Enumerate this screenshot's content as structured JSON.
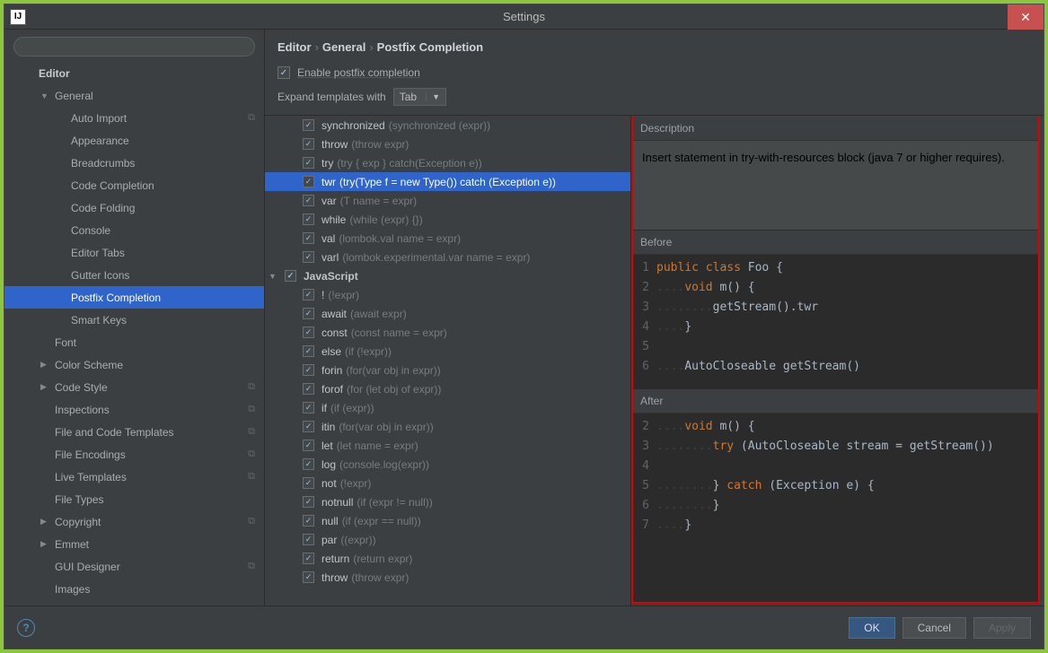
{
  "window": {
    "title": "Settings",
    "app_icon": "IJ"
  },
  "search": {
    "placeholder": ""
  },
  "sidebar": {
    "header": "Editor",
    "items": [
      {
        "label": "General",
        "level": 1,
        "expandable": true,
        "expanded": true
      },
      {
        "label": "Auto Import",
        "level": 2,
        "copy": true
      },
      {
        "label": "Appearance",
        "level": 2
      },
      {
        "label": "Breadcrumbs",
        "level": 2
      },
      {
        "label": "Code Completion",
        "level": 2
      },
      {
        "label": "Code Folding",
        "level": 2
      },
      {
        "label": "Console",
        "level": 2
      },
      {
        "label": "Editor Tabs",
        "level": 2
      },
      {
        "label": "Gutter Icons",
        "level": 2
      },
      {
        "label": "Postfix Completion",
        "level": 2,
        "selected": true
      },
      {
        "label": "Smart Keys",
        "level": 2
      },
      {
        "label": "Font",
        "level": 1
      },
      {
        "label": "Color Scheme",
        "level": 1,
        "expandable": true
      },
      {
        "label": "Code Style",
        "level": 1,
        "expandable": true,
        "copy": true
      },
      {
        "label": "Inspections",
        "level": 1,
        "copy": true
      },
      {
        "label": "File and Code Templates",
        "level": 1,
        "copy": true
      },
      {
        "label": "File Encodings",
        "level": 1,
        "copy": true
      },
      {
        "label": "Live Templates",
        "level": 1,
        "copy": true
      },
      {
        "label": "File Types",
        "level": 1
      },
      {
        "label": "Copyright",
        "level": 1,
        "expandable": true,
        "copy": true
      },
      {
        "label": "Emmet",
        "level": 1,
        "expandable": true
      },
      {
        "label": "GUI Designer",
        "level": 1,
        "copy": true
      },
      {
        "label": "Images",
        "level": 1
      }
    ]
  },
  "breadcrumb": {
    "parts": [
      "Editor",
      "General",
      "Postfix Completion"
    ]
  },
  "enable": {
    "label": "Enable postfix completion",
    "checked": true
  },
  "expand": {
    "label": "Expand templates with",
    "value": "Tab"
  },
  "templates": {
    "rows": [
      {
        "type": "item",
        "key": "synchronized",
        "desc": "(synchronized (expr))"
      },
      {
        "type": "item",
        "key": "throw",
        "desc": "(throw expr)"
      },
      {
        "type": "item",
        "key": "try",
        "desc": "(try { exp } catch(Exception e))"
      },
      {
        "type": "item",
        "key": "twr",
        "desc": "(try(Type f = new Type()) catch (Exception e))",
        "selected": true
      },
      {
        "type": "item",
        "key": "var",
        "desc": "(T name = expr)"
      },
      {
        "type": "item",
        "key": "while",
        "desc": "(while (expr) {})"
      },
      {
        "type": "item",
        "key": "val",
        "desc": "(lombok.val name = expr)"
      },
      {
        "type": "item",
        "key": "varl",
        "desc": "(lombok.experimental.var name = expr)"
      },
      {
        "type": "group",
        "key": "JavaScript"
      },
      {
        "type": "item",
        "key": "!",
        "desc": "(!expr)"
      },
      {
        "type": "item",
        "key": "await",
        "desc": "(await expr)"
      },
      {
        "type": "item",
        "key": "const",
        "desc": "(const name = expr)"
      },
      {
        "type": "item",
        "key": "else",
        "desc": "(if (!expr))"
      },
      {
        "type": "item",
        "key": "forin",
        "desc": "(for(var obj in expr))"
      },
      {
        "type": "item",
        "key": "forof",
        "desc": "(for (let obj of expr))"
      },
      {
        "type": "item",
        "key": "if",
        "desc": "(if (expr))"
      },
      {
        "type": "item",
        "key": "itin",
        "desc": "(for(var obj in expr))"
      },
      {
        "type": "item",
        "key": "let",
        "desc": "(let name = expr)"
      },
      {
        "type": "item",
        "key": "log",
        "desc": "(console.log(expr))"
      },
      {
        "type": "item",
        "key": "not",
        "desc": "(!expr)"
      },
      {
        "type": "item",
        "key": "notnull",
        "desc": "(if (expr != null))"
      },
      {
        "type": "item",
        "key": "null",
        "desc": "(if (expr == null))"
      },
      {
        "type": "item",
        "key": "par",
        "desc": "((expr))"
      },
      {
        "type": "item",
        "key": "return",
        "desc": "(return expr)"
      },
      {
        "type": "item",
        "key": "throw",
        "desc": "(throw expr)"
      }
    ]
  },
  "preview": {
    "desc_label": "Description",
    "description": "Insert statement in try-with-resources block (java 7 or higher requires).",
    "before_label": "Before",
    "before_lines": [
      {
        "n": "1",
        "tokens": [
          [
            "kw",
            "public"
          ],
          [
            "p",
            " "
          ],
          [
            "kw",
            "class"
          ],
          [
            "p",
            " Foo {"
          ]
        ]
      },
      {
        "n": "2",
        "tokens": [
          [
            "dots",
            "...."
          ],
          [
            "kw",
            "void"
          ],
          [
            "p",
            " m() {"
          ]
        ]
      },
      {
        "n": "3",
        "tokens": [
          [
            "dots",
            "........"
          ],
          [
            "p",
            "getStream().twr"
          ]
        ]
      },
      {
        "n": "4",
        "tokens": [
          [
            "dots",
            "...."
          ],
          [
            "p",
            "}"
          ]
        ]
      },
      {
        "n": "5",
        "tokens": []
      },
      {
        "n": "6",
        "tokens": [
          [
            "dots",
            "...."
          ],
          [
            "p",
            "AutoCloseable getStream()"
          ]
        ]
      }
    ],
    "after_label": "After",
    "after_lines": [
      {
        "n": "2",
        "tokens": [
          [
            "dots",
            "...."
          ],
          [
            "kw",
            "void"
          ],
          [
            "p",
            " m() {"
          ]
        ]
      },
      {
        "n": "3",
        "tokens": [
          [
            "dots",
            "........"
          ],
          [
            "kw",
            "try"
          ],
          [
            "p",
            " (AutoCloseable stream = getStream())"
          ]
        ]
      },
      {
        "n": "4",
        "tokens": []
      },
      {
        "n": "5",
        "tokens": [
          [
            "dots",
            "........"
          ],
          [
            "p",
            "} "
          ],
          [
            "kw",
            "catch"
          ],
          [
            "p",
            " (Exception e) {"
          ]
        ]
      },
      {
        "n": "6",
        "tokens": [
          [
            "dots",
            "........"
          ],
          [
            "p",
            "}"
          ]
        ]
      },
      {
        "n": "7",
        "tokens": [
          [
            "dots",
            "...."
          ],
          [
            "p",
            "}"
          ]
        ]
      }
    ]
  },
  "footer": {
    "ok": "OK",
    "cancel": "Cancel",
    "apply": "Apply"
  }
}
